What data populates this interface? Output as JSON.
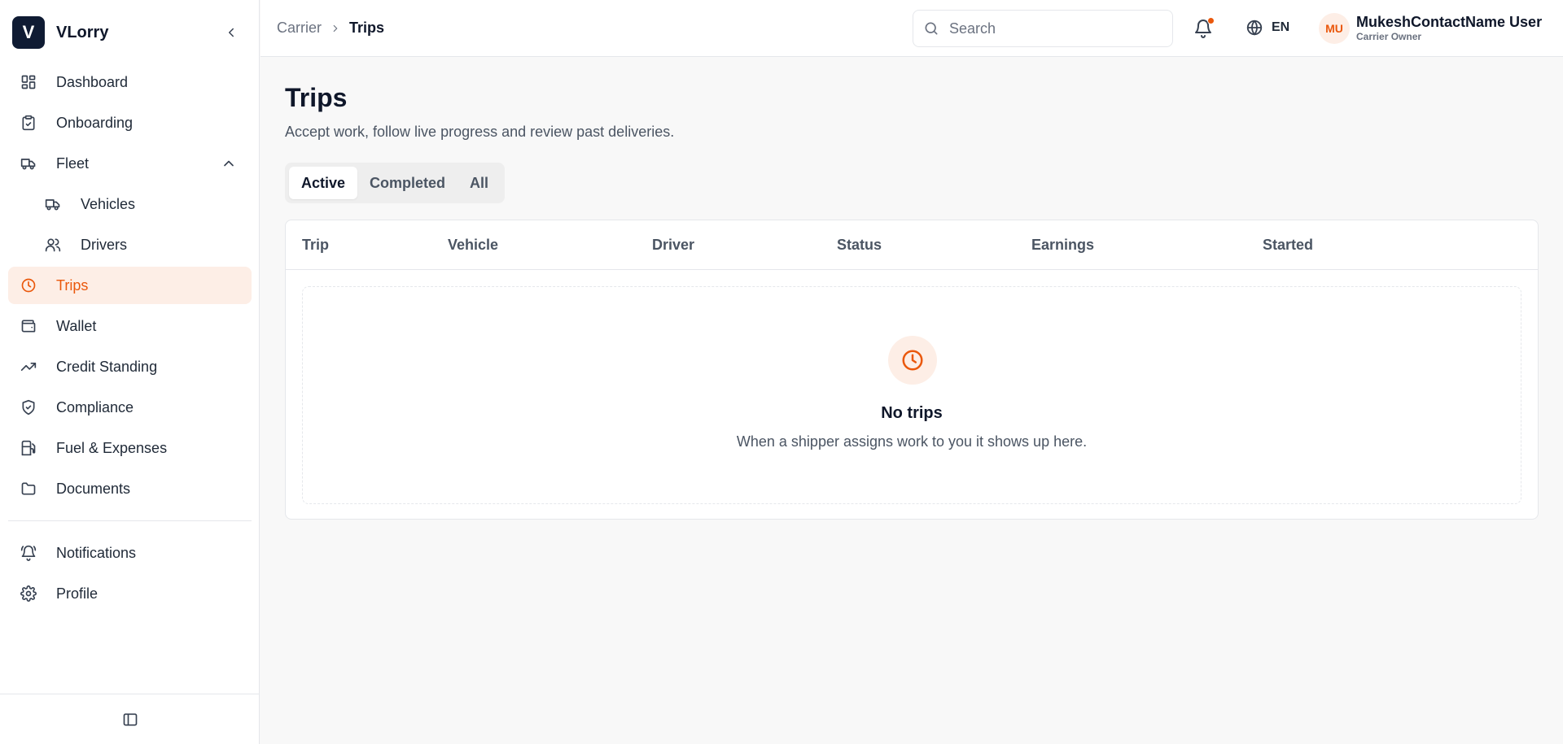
{
  "brand": {
    "logo_letter": "V",
    "name": "VLorry"
  },
  "sidebar": {
    "items": [
      {
        "label": "Dashboard",
        "icon": "dashboard-icon"
      },
      {
        "label": "Onboarding",
        "icon": "clipboard-check-icon"
      },
      {
        "label": "Fleet",
        "icon": "truck-icon",
        "expanded": true
      },
      {
        "label": "Vehicles",
        "icon": "truck-icon"
      },
      {
        "label": "Drivers",
        "icon": "users-icon"
      },
      {
        "label": "Trips",
        "icon": "clock-icon",
        "active": true
      },
      {
        "label": "Wallet",
        "icon": "wallet-icon"
      },
      {
        "label": "Credit Standing",
        "icon": "trending-up-icon"
      },
      {
        "label": "Compliance",
        "icon": "shield-check-icon"
      },
      {
        "label": "Fuel & Expenses",
        "icon": "fuel-icon"
      },
      {
        "label": "Documents",
        "icon": "folder-icon"
      }
    ],
    "bottom_items": [
      {
        "label": "Notifications",
        "icon": "bell-ring-icon"
      },
      {
        "label": "Profile",
        "icon": "gear-icon"
      }
    ]
  },
  "header": {
    "breadcrumb": [
      "Carrier",
      "Trips"
    ],
    "search_placeholder": "Search",
    "language": "EN",
    "user": {
      "initials": "MU",
      "name": "MukeshContactName User",
      "role": "Carrier Owner"
    }
  },
  "main": {
    "title": "Trips",
    "subtitle": "Accept work, follow live progress and review past deliveries.",
    "tabs": [
      {
        "label": "Active",
        "active": true
      },
      {
        "label": "Completed"
      },
      {
        "label": "All"
      }
    ],
    "table": {
      "columns": [
        "Trip",
        "Vehicle",
        "Driver",
        "Status",
        "Earnings",
        "Started"
      ]
    },
    "empty": {
      "title": "No trips",
      "text": "When a shipper assigns work to you it shows up here."
    }
  },
  "colors": {
    "accent": "#ea580c",
    "accent_bg": "#fdeee6",
    "brand_dark": "#0f1b33"
  }
}
